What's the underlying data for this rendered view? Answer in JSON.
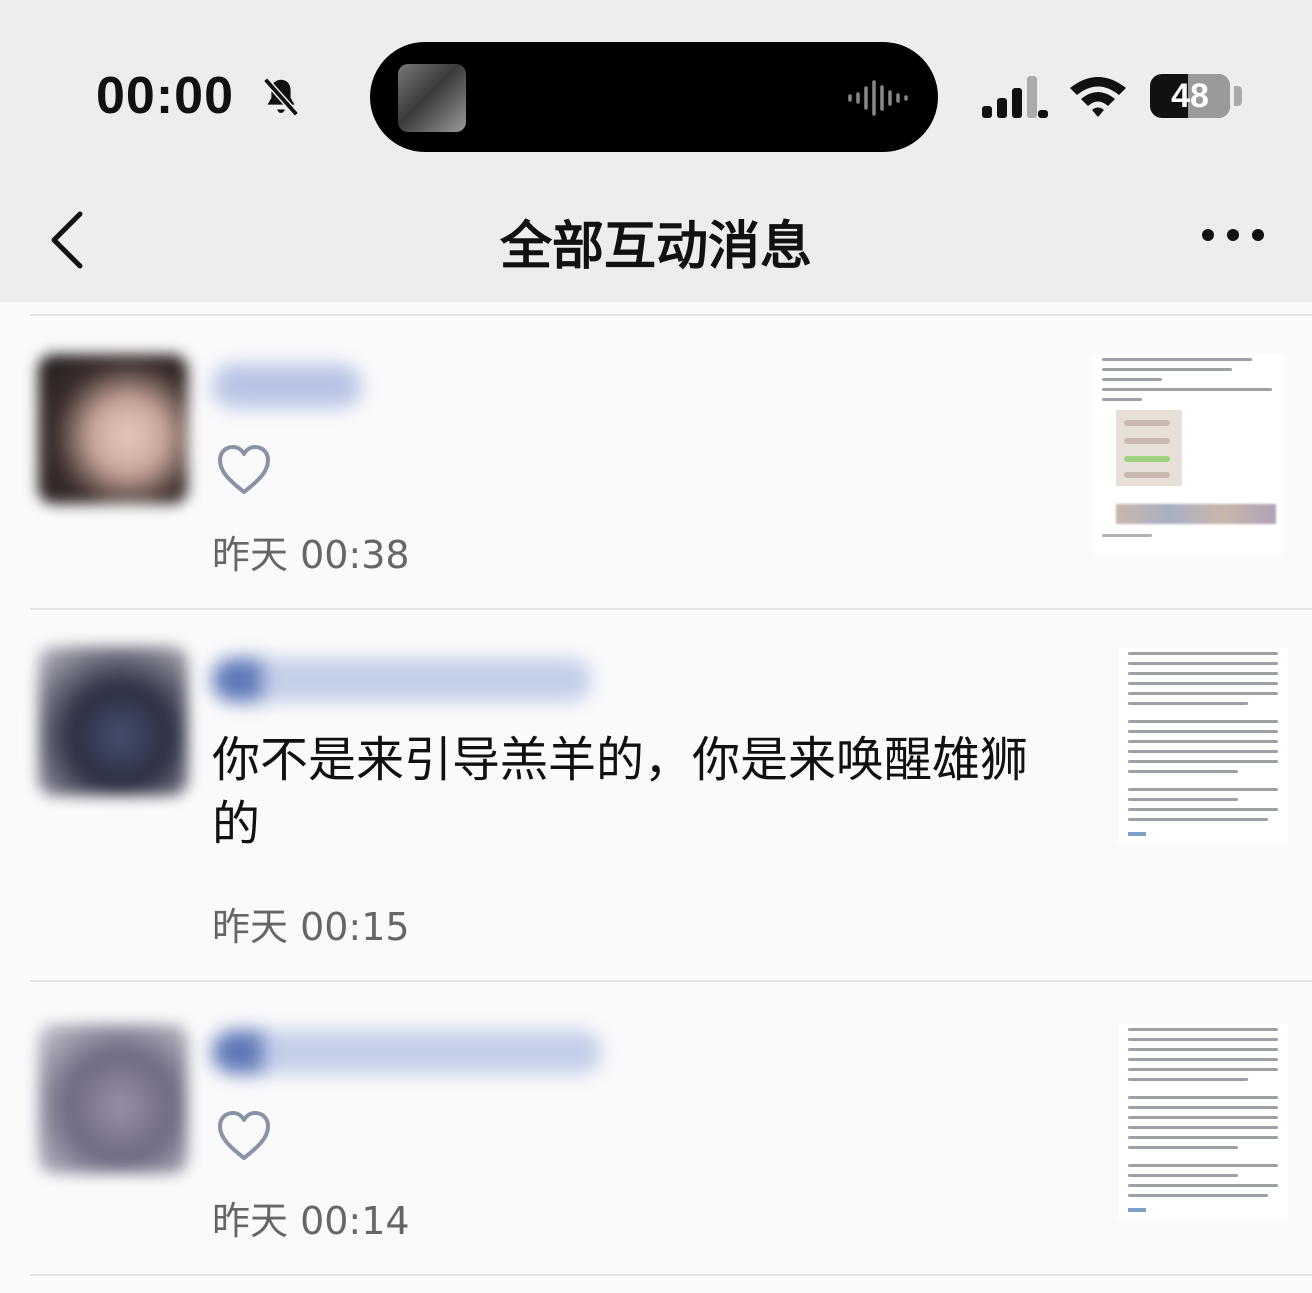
{
  "status_bar": {
    "time": "00:00",
    "battery": "48",
    "battery_level": 0.48,
    "icons": [
      "bell-mute-icon",
      "signal-icon",
      "wifi-icon",
      "battery-icon"
    ]
  },
  "nav": {
    "title": "全部互动消息",
    "back_icon": "chevron-left-icon",
    "more_icon": "more-dots-icon"
  },
  "messages": [
    {
      "type": "like",
      "time": "昨天 00:38",
      "icon": "heart-outline-icon"
    },
    {
      "type": "comment",
      "comment": "你不是来引导羔羊的，你是来唤醒雄狮的",
      "time": "昨天 00:15"
    },
    {
      "type": "like",
      "time": "昨天 00:14",
      "icon": "heart-outline-icon"
    }
  ],
  "colors": {
    "header_bg": "#ededed",
    "list_bg": "#fafafb",
    "timestamp": "#666666",
    "heart": "#8a93a6"
  }
}
